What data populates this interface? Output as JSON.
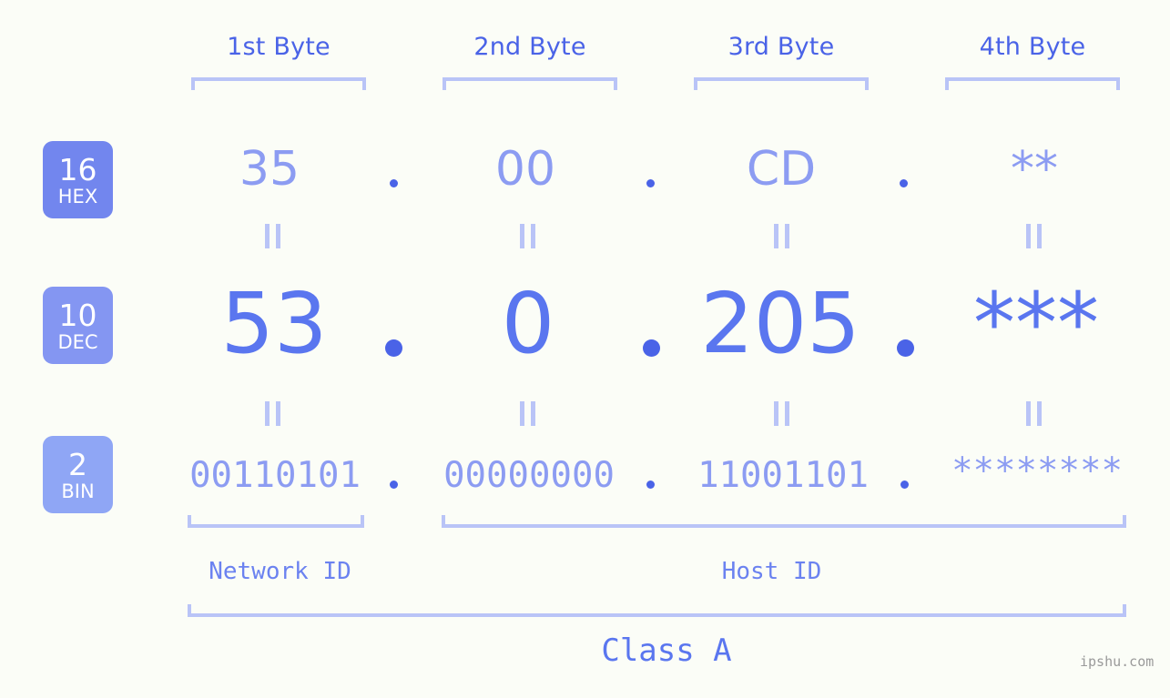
{
  "page": {
    "background_color": "#fbfdf7",
    "accent_color": "#4a63e7",
    "light_accent_color": "#b9c4f7",
    "watermark": "ipshu.com"
  },
  "byte_headers": [
    {
      "label": "1st Byte"
    },
    {
      "label": "2nd Byte"
    },
    {
      "label": "3rd Byte"
    },
    {
      "label": "4th Byte"
    }
  ],
  "rows": [
    {
      "base": "16",
      "base_name": "HEX",
      "badge_color": "#7286ee",
      "octets": [
        "35",
        "00",
        "CD",
        "**"
      ],
      "separator": "."
    },
    {
      "base": "10",
      "base_name": "DEC",
      "badge_color": "#8496f2",
      "octets": [
        "53",
        "0",
        "205",
        "***"
      ],
      "separator": "."
    },
    {
      "base": "2",
      "base_name": "BIN",
      "badge_color": "#8fa6f5",
      "octets": [
        "00110101",
        "00000000",
        "11001101",
        "********"
      ],
      "separator": "."
    }
  ],
  "equivalence_marks": [
    {
      "label": "||"
    },
    {
      "label": "||"
    },
    {
      "label": "||"
    },
    {
      "label": "||"
    },
    {
      "label": "||"
    },
    {
      "label": "||"
    },
    {
      "label": "||"
    },
    {
      "label": "||"
    }
  ],
  "id_sections": [
    {
      "label": "Network ID"
    },
    {
      "label": "Host ID"
    }
  ],
  "class_section": {
    "label": "Class A"
  }
}
